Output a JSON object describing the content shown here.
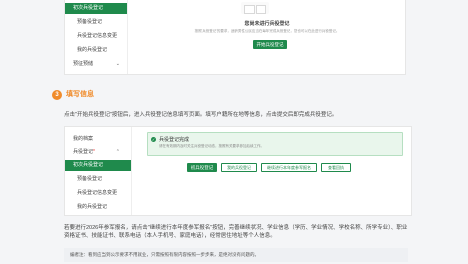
{
  "top_card": {
    "sidebar": [
      {
        "label": "初次兵役登记",
        "active": true
      },
      {
        "label": "预备役登记"
      },
      {
        "label": "兵役登记信息变更"
      },
      {
        "label": "我的兵役登记"
      },
      {
        "label": "预征预储"
      }
    ],
    "empty_title": "您尚未进行兵役登记",
    "empty_desc": "按照'兵役登记'的要求，适龄男性公民应当在每年完成兵役登记，您也可以在此进行兵役登记。",
    "start_button": "开始兵役登记"
  },
  "section": {
    "number": "3",
    "title": "填写信息",
    "instruction": "点击\"开始兵役登记\"按钮后，进入兵役登记信息填写页面。填写户籍所在地等信息，点击提交后即完成兵役登记。"
  },
  "second_card": {
    "sidebar": [
      {
        "label": "我的档案"
      },
      {
        "label": "兵役登记",
        "required_mark": "*"
      },
      {
        "label": "初次兵役登记",
        "active": true
      },
      {
        "label": "预备役登记"
      },
      {
        "label": "兵役登记信息变更"
      },
      {
        "label": "我的兵役登记"
      }
    ],
    "alert_title": "兵役登记完成",
    "alert_desc": "请在有效期内及时关注兵役登记动态，按照有关要求参加后续工作。",
    "buttons": [
      "初兵役登记",
      "我的兵役登记",
      "继续进行本年度参军报名",
      "查看回执"
    ]
  },
  "paragraph2": "若要进行2026年参军报名，请点击\"继续进行本年度参军报名\"按钮，完善继续状况、学业信息（学历、学业情况、学校名称、所学专业）、职业资格证书、技能证书、联系电话（本人手机号、家庭电话），经常居住地址等个人信息。",
  "note": "编者注：看到应当到公示要求不用就业，只需按照有限内容按照一步步来，是绝对没有问题的。",
  "colors": {
    "accent_green": "#1f8a4c",
    "accent_orange": "#f08b2b"
  }
}
